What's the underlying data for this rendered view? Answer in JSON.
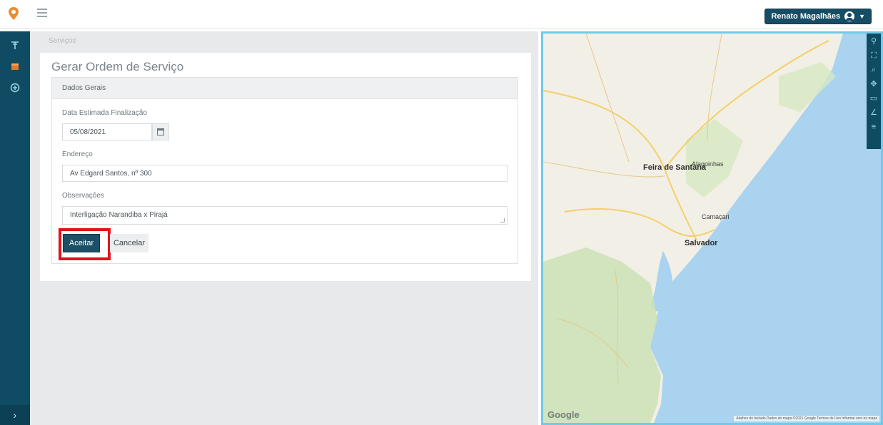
{
  "header": {
    "user_name": "Renato Magalhães"
  },
  "breadcrumb": "Serviços",
  "page_title": "Gerar Ordem de Serviço",
  "card_title": "Dados Gerais",
  "form": {
    "date_label": "Data Estimada Finalização",
    "date_value": "05/08/2021",
    "address_label": "Endereço",
    "address_value": "Av Edgard Santos, nº 300",
    "notes_label": "Observações",
    "notes_value": "Interligação Narandiba x Pirajá",
    "accept_label": "Aceitar",
    "cancel_label": "Cancelar"
  },
  "map": {
    "cities": [
      "Feira de Santana",
      "Salvador",
      "Camaçari",
      "Alagoinhas"
    ],
    "google_logo": "Google",
    "attribution": "Atalhos do teclado   Dados do mapa ©2021 Google   Termos de Uso   Informar erro no mapa"
  },
  "colors": {
    "brand_dark": "#0f4c63",
    "highlight": "#e0141e",
    "map_border": "#6fcbe8",
    "sea": "#a9d3ef"
  }
}
